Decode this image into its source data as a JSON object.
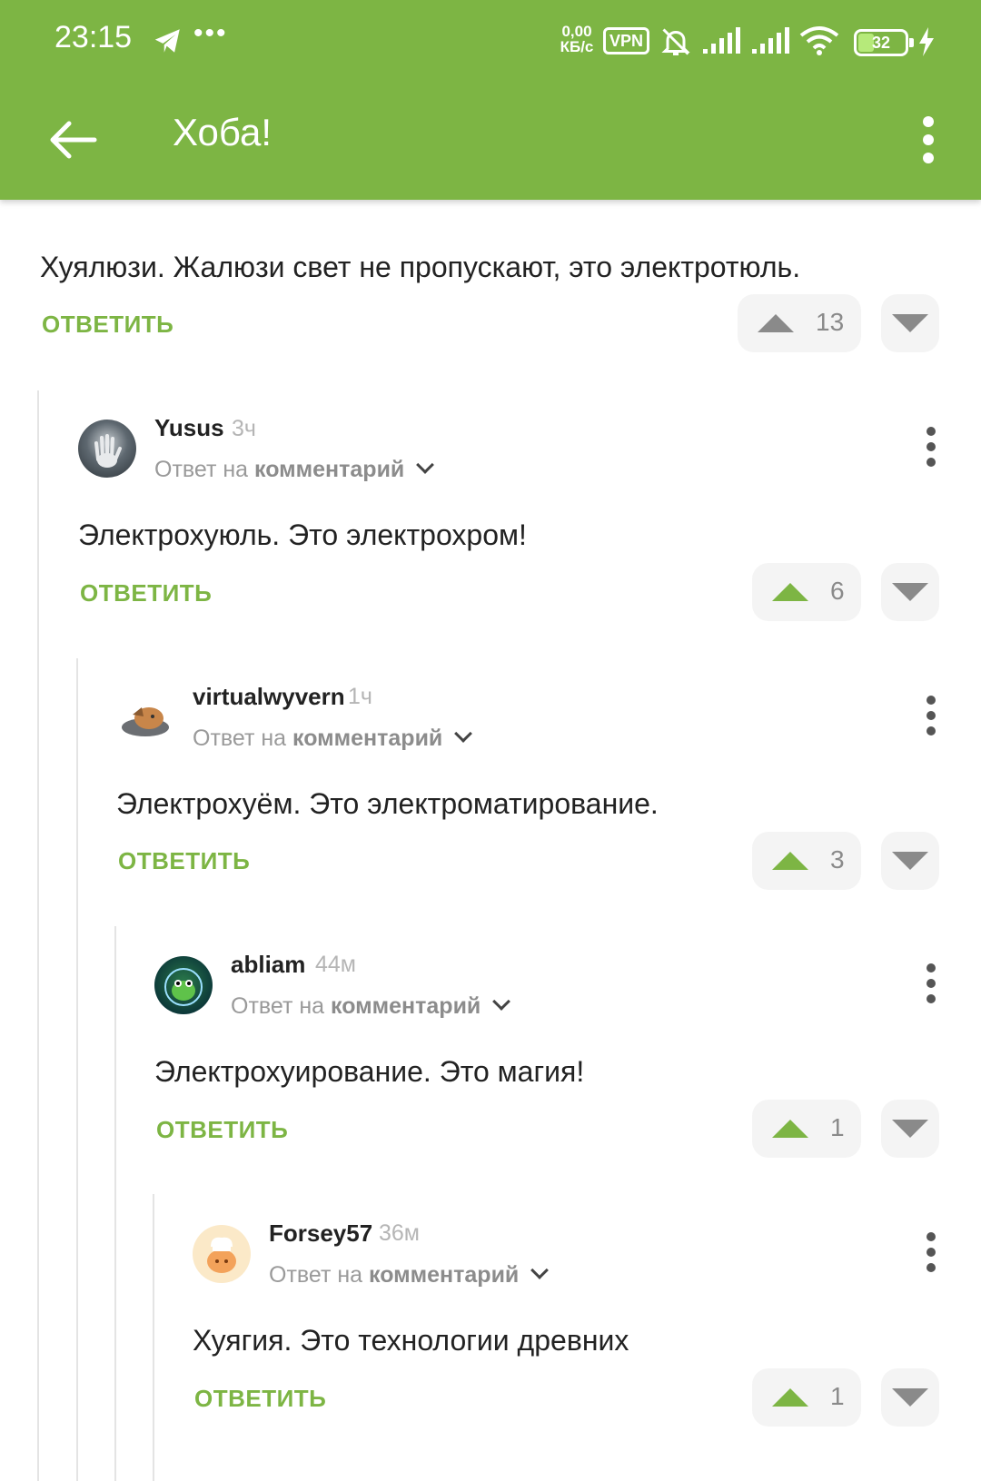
{
  "status_bar": {
    "time": "23:15",
    "dots": "•••",
    "speed_value": "0,00",
    "speed_unit": "КБ/с",
    "vpn": "VPN",
    "battery": "32"
  },
  "app_bar": {
    "title": "Хоба!"
  },
  "top_comment": {
    "text": "Хуялюзи. Жалюзи свет не пропускают, это электротюль.",
    "reply_label": "ОТВЕТИТЬ",
    "votes": "13"
  },
  "comments": [
    {
      "author": "Yusus",
      "time": "3ч",
      "reply_prefix": "Ответ на",
      "reply_target": "комментарий",
      "text": "Электрохуюль. Это электрохром!",
      "reply_label": "ОТВЕТИТЬ",
      "votes": "6"
    },
    {
      "author": "virtualwyvern",
      "time": "1ч",
      "reply_prefix": "Ответ на",
      "reply_target": "комментарий",
      "text": "Электрохуём. Это электроматирование.",
      "reply_label": "ОТВЕТИТЬ",
      "votes": "3"
    },
    {
      "author": "abliam",
      "time": "44м",
      "reply_prefix": "Ответ на",
      "reply_target": "комментарий",
      "text": "Электрохуирование. Это магия!",
      "reply_label": "ОТВЕТИТЬ",
      "votes": "1"
    },
    {
      "author": "Forsey57",
      "time": "36м",
      "reply_prefix": "Ответ на",
      "reply_target": "комментарий",
      "text": "Хуягия. Это технологии древних",
      "reply_label": "ОТВЕТИТЬ",
      "votes": "1"
    }
  ],
  "colors": {
    "accent": "#7db544",
    "vote_bg": "#f4f4f4",
    "muted": "#8a8a8a"
  }
}
